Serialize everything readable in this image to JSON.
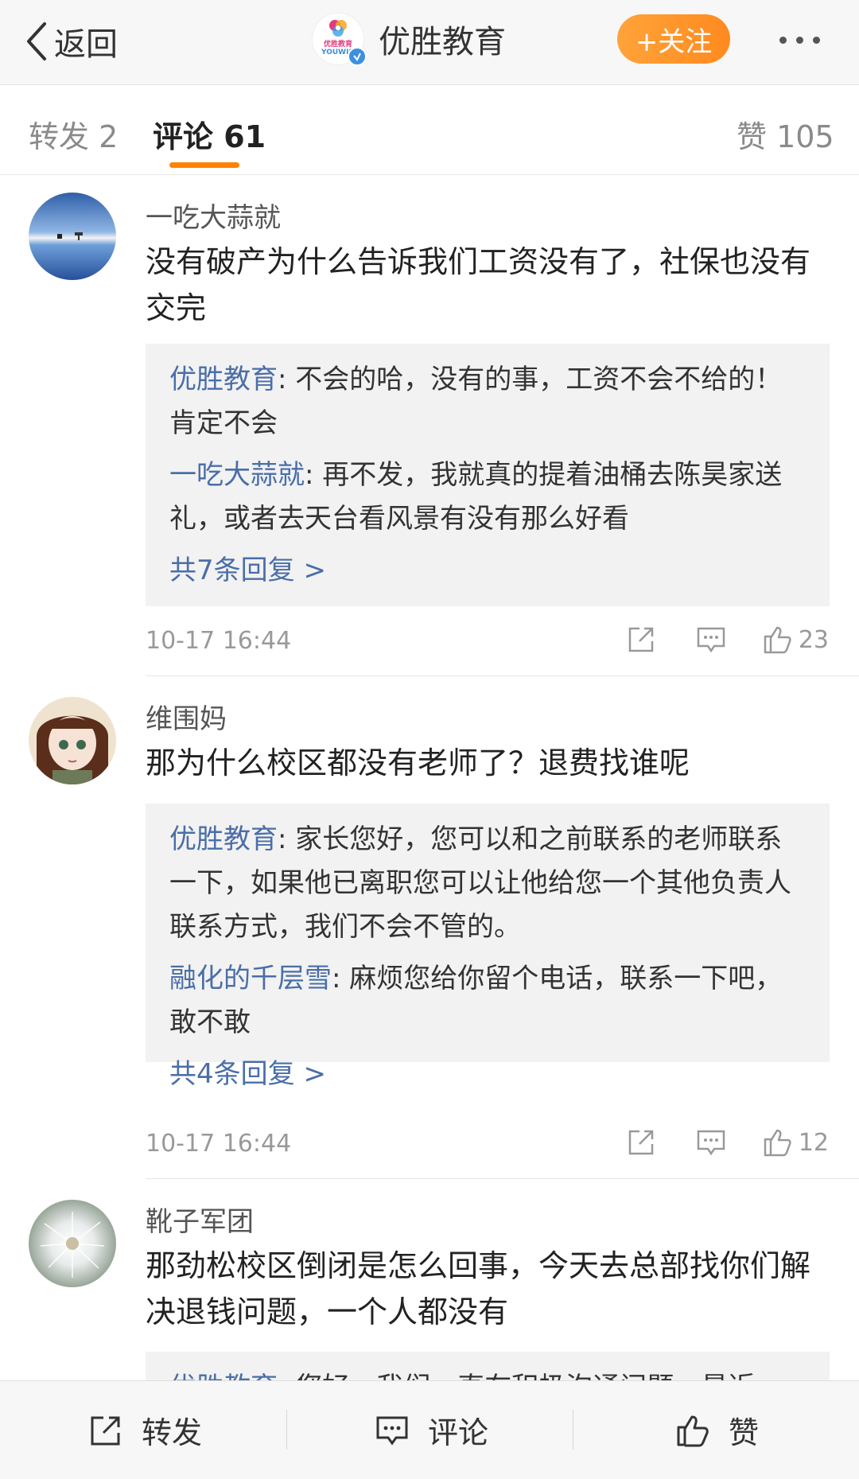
{
  "header": {
    "back_label": "返回",
    "account_name": "优胜教育",
    "logo_text": "优胜教育",
    "logo_subtext": "YOUWIN",
    "follow_label": "+关注"
  },
  "tabs": {
    "repost": "转发 2",
    "comments": "评论 61",
    "likes": "赞 105"
  },
  "comments": [
    {
      "user": "一吃大蒜就",
      "text": "没有破产为什么告诉我们工资没有了，社保也没有交完",
      "replies": [
        {
          "name": "优胜教育",
          "text": ": 不会的哈，没有的事，工资不会不给的！肯定不会"
        },
        {
          "name": "一吃大蒜就",
          "text": ": 再不发，我就真的提着油桶去陈昊家送礼，或者去天台看风景有没有那么好看"
        }
      ],
      "more_replies": "共7条回复 >",
      "time": "10-17 16:44",
      "likes": "23"
    },
    {
      "user": "维围妈",
      "text": "那为什么校区都没有老师了？退费找谁呢",
      "replies": [
        {
          "name": "优胜教育",
          "text": ": 家长您好，您可以和之前联系的老师联系一下，如果他已离职您可以让他给您一个其他负责人联系方式，我们不会不管的。"
        },
        {
          "name": "融化的千层雪",
          "text": ": 麻烦您给你留个电话，联系一下吧，敢不敢"
        }
      ],
      "more_replies": "共4条回复 >",
      "time": "10-17 16:44",
      "likes": "12"
    },
    {
      "user": "靴子军团",
      "text": "那劲松校区倒闭是怎么回事，今天去总部找你们解决退钱问题，一个人都没有",
      "replies": [
        {
          "name": "优胜教育",
          "text": ": 您好，我们一直在积极沟通问题，最近"
        }
      ]
    }
  ],
  "bottom_bar": {
    "repost": "转发",
    "comment": "评论",
    "like": "赞"
  },
  "colors": {
    "accent_orange": "#ff8200",
    "link_blue": "#4a6ea8"
  }
}
